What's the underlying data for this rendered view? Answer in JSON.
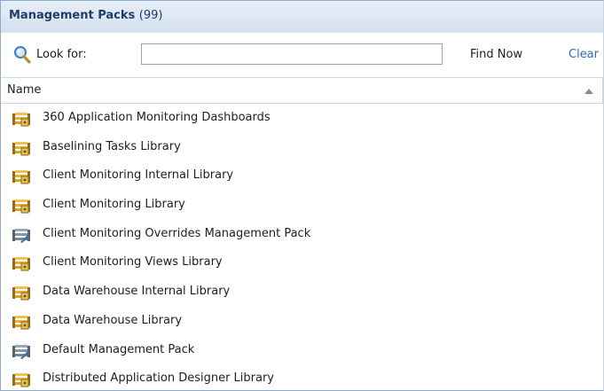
{
  "header": {
    "title": "Management Packs",
    "count": "(99)"
  },
  "search": {
    "look_for_label": "Look for:",
    "value": "",
    "find_now_label": "Find Now",
    "clear_label": "Clear"
  },
  "columns": {
    "name": "Name"
  },
  "rows": [
    {
      "label": "360 Application Monitoring Dashboards",
      "icon": "sealed-mp-icon"
    },
    {
      "label": "Baselining Tasks Library",
      "icon": "sealed-mp-icon"
    },
    {
      "label": "Client Monitoring Internal Library",
      "icon": "sealed-mp-icon"
    },
    {
      "label": "Client Monitoring Library",
      "icon": "sealed-mp-icon"
    },
    {
      "label": "Client Monitoring Overrides Management Pack",
      "icon": "unsealed-mp-icon"
    },
    {
      "label": "Client Monitoring Views Library",
      "icon": "sealed-mp-icon"
    },
    {
      "label": "Data Warehouse Internal Library",
      "icon": "sealed-mp-icon"
    },
    {
      "label": "Data Warehouse Library",
      "icon": "sealed-mp-icon"
    },
    {
      "label": "Default Management Pack",
      "icon": "unsealed-mp-icon"
    },
    {
      "label": "Distributed Application Designer Library",
      "icon": "sealed-mp-icon"
    }
  ]
}
